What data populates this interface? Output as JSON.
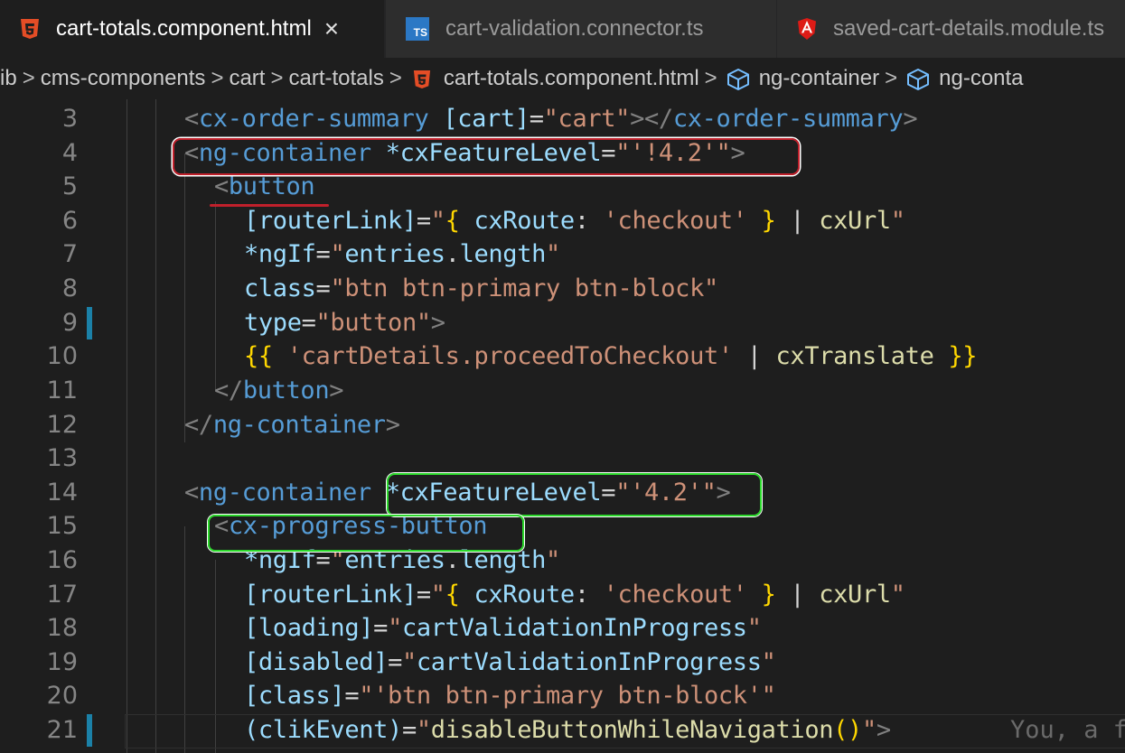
{
  "tabs": [
    {
      "label": "cart-totals.component.html",
      "icon": "html5-icon",
      "active": true,
      "close": "×"
    },
    {
      "label": "cart-validation.connector.ts",
      "icon": "typescript-icon",
      "badge": "TS",
      "active": false
    },
    {
      "label": "saved-cart-details.module.ts",
      "icon": "angular-icon",
      "active": false
    }
  ],
  "breadcrumb": {
    "items": [
      "ib",
      "cms-components",
      "cart",
      "cart-totals",
      "cart-totals.component.html",
      "ng-container",
      "ng-conta"
    ],
    "separator": ">"
  },
  "editor": {
    "line_numbers": [
      "3",
      "4",
      "5",
      "6",
      "7",
      "8",
      "9",
      "10",
      "11",
      "12",
      "13",
      "14",
      "15",
      "16",
      "17",
      "18",
      "19",
      "20",
      "21"
    ],
    "ghost_text": "You, a f"
  },
  "colors": {
    "background": "#1e1e1e",
    "tag": "#569cd6",
    "attribute": "#9cdcfe",
    "string": "#ce9178",
    "function": "#dcdcaa",
    "annotation_red": "#c0202b",
    "annotation_green": "#2bd82b"
  }
}
